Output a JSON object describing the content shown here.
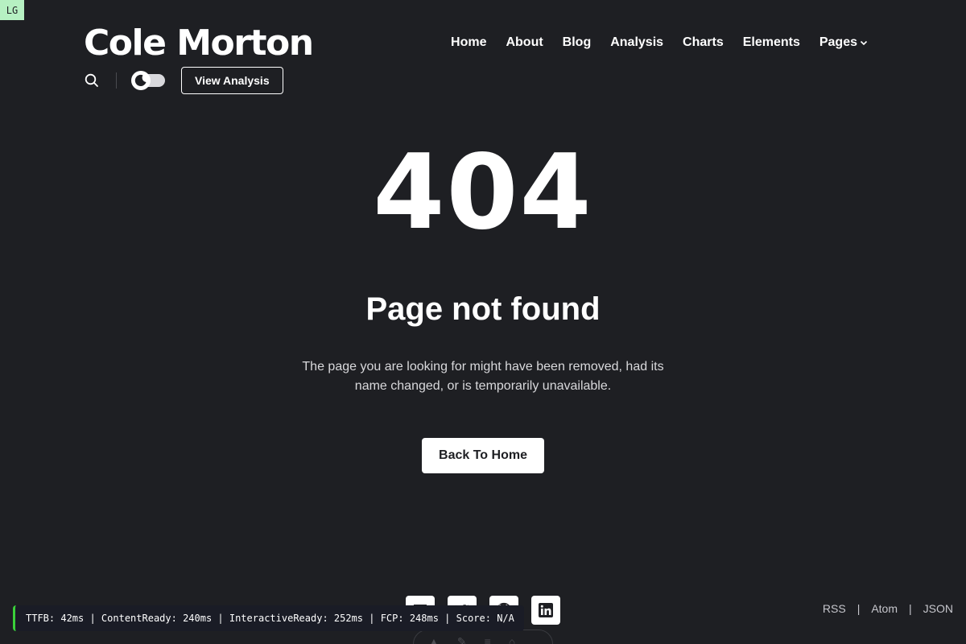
{
  "breakpoint_badge": "LG",
  "site": {
    "logo": "Cole Morton"
  },
  "nav": {
    "items": [
      {
        "label": "Home"
      },
      {
        "label": "About"
      },
      {
        "label": "Blog"
      },
      {
        "label": "Analysis"
      },
      {
        "label": "Charts"
      },
      {
        "label": "Elements"
      },
      {
        "label": "Pages",
        "icon": "chevron-down-icon"
      }
    ]
  },
  "toolbar": {
    "search_icon": "search-icon",
    "theme_toggle_icon": "moon-icon",
    "view_analysis_label": "View Analysis"
  },
  "error": {
    "code": "404",
    "title": "Page not found",
    "description": "The page you are looking for might have been removed, had its name changed, or is temporarily unavailable.",
    "back_button": "Back To Home"
  },
  "footer": {
    "socials": [
      "rss-square-icon",
      "twitter-icon",
      "github-icon",
      "linkedin-icon"
    ],
    "feeds": [
      "RSS",
      "Atom",
      "JSON"
    ],
    "separator": "|"
  },
  "perf_bar": {
    "text": "TTFB: 42ms | ContentReady: 240ms | InteractiveReady: 252ms | FCP: 248ms | Score: N/A"
  },
  "colors": {
    "background": "#1e1f23",
    "text": "#ffffff",
    "badge_bg": "#b6f0c2",
    "perf_accent": "#3ad13a"
  }
}
